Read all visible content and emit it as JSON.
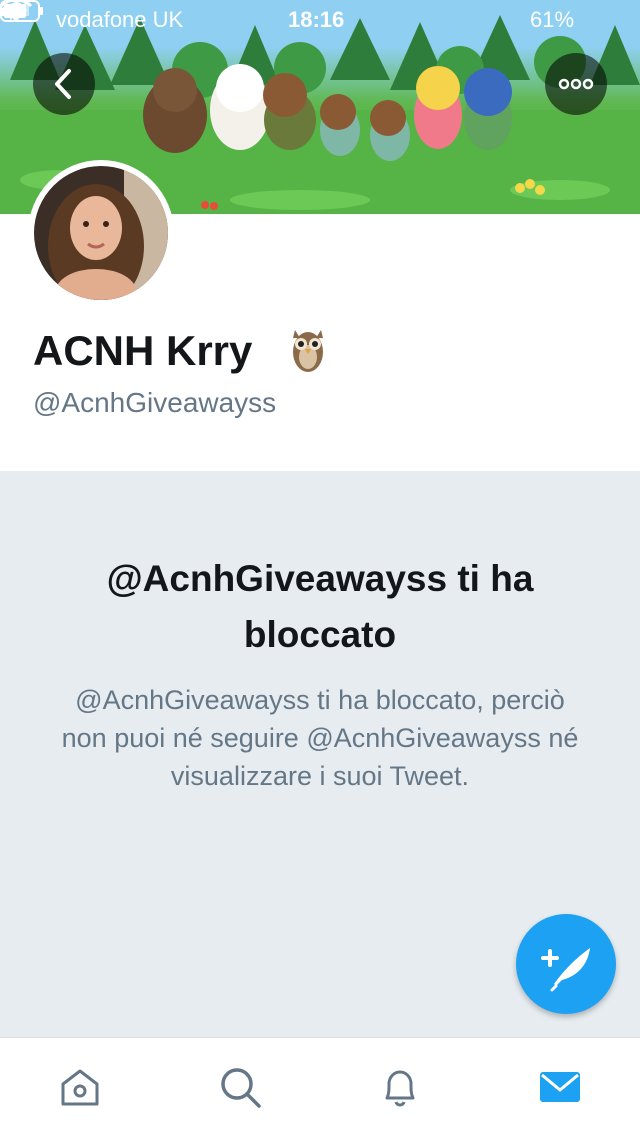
{
  "status_bar": {
    "carrier": "vodafone UK",
    "time": "18:16",
    "battery": "61%"
  },
  "profile": {
    "name": "ACNH Krry",
    "handle": "@AcnhGiveawayss"
  },
  "blocked": {
    "title": "@AcnhGiveawayss ti ha bloccato",
    "message": "@AcnhGiveawayss ti ha bloccato, perciò non puoi né seguire @AcnhGiveawayss né visualizzare i suoi Tweet."
  },
  "colors": {
    "accent": "#1da1f2",
    "panel_bg": "#e6ecf0",
    "text_primary": "#14171a",
    "text_secondary": "#657786"
  },
  "icons": {
    "back": "chevron-left-icon",
    "more": "more-icon",
    "compose": "compose-tweet-icon",
    "tabs": [
      "home-icon",
      "search-icon",
      "notifications-icon",
      "messages-icon"
    ]
  }
}
